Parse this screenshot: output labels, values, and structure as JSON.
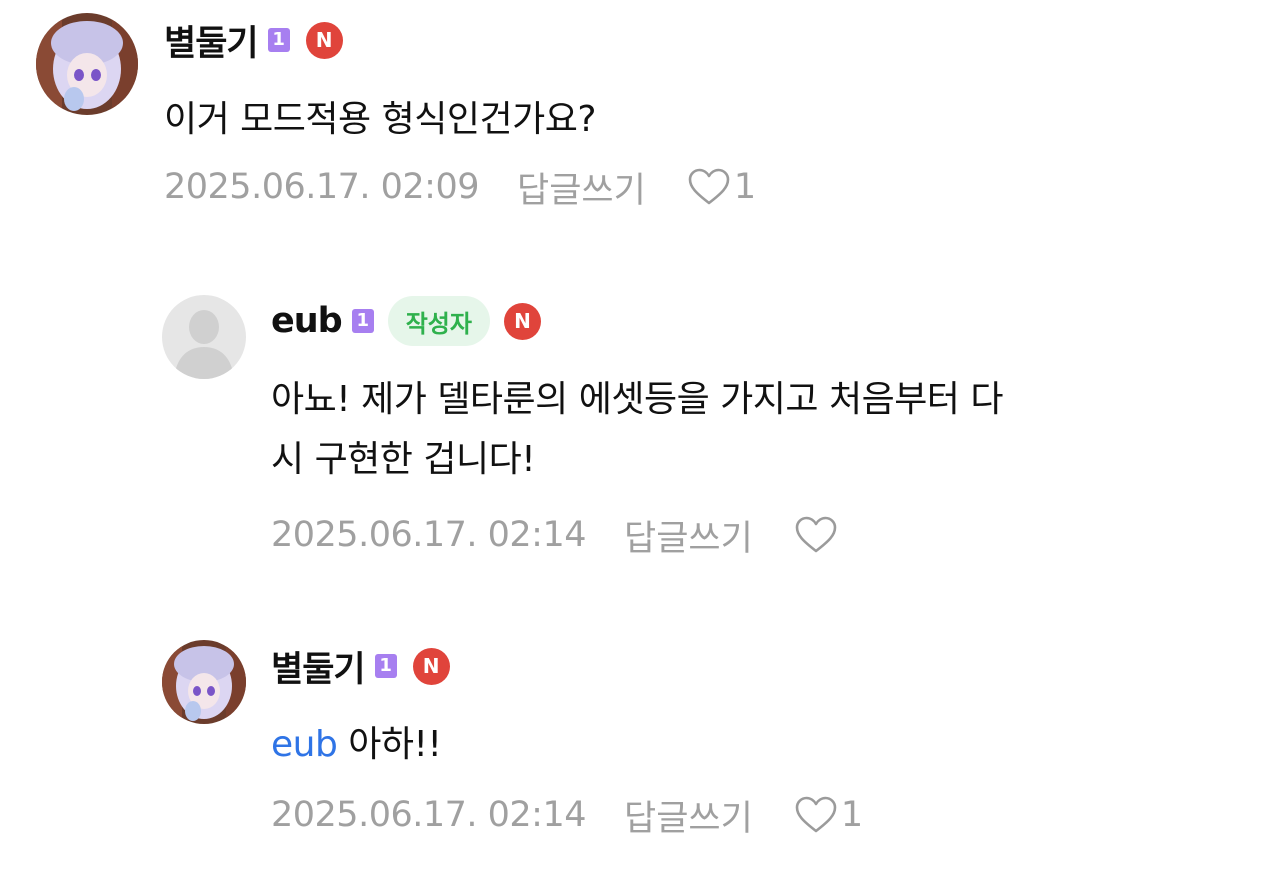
{
  "comments": [
    {
      "author": "별둘기",
      "level_badge": "1",
      "new_badge": "N",
      "text": "이거 모드적용 형식인건가요?",
      "date": "2025.06.17. 02:09",
      "reply_label": "답글쓰기",
      "like_count": "1"
    },
    {
      "author": "eub",
      "level_badge": "1",
      "writer_badge": "작성자",
      "new_badge": "N",
      "text_line1": "아뇨! 제가 델타룬의 에셋등을 가지고 처음부터 다",
      "text_line2": "시 구현한 겁니다!",
      "date": "2025.06.17. 02:14",
      "reply_label": "답글쓰기",
      "like_count": ""
    },
    {
      "author": "별둘기",
      "level_badge": "1",
      "new_badge": "N",
      "mention": "eub",
      "text": " 아하!!",
      "date": "2025.06.17. 02:14",
      "reply_label": "답글쓰기",
      "like_count": "1"
    }
  ],
  "icons": {
    "avatar_user": "anime-avatar-icon",
    "avatar_default": "default-profile-icon",
    "like": "heart-outline-icon"
  },
  "colors": {
    "level_badge": "#a77ff0",
    "writer_badge_bg": "#e6f6ea",
    "writer_badge_text": "#2fb14d",
    "new_badge": "#e0443b",
    "mention": "#2f74e6",
    "meta": "#a0a0a0"
  }
}
